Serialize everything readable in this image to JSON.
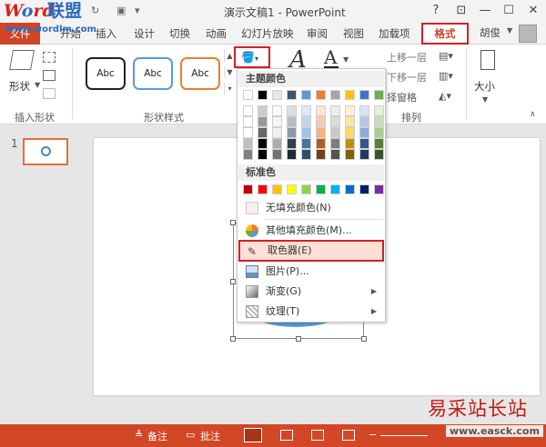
{
  "logo": {
    "part1": "W",
    "part2": "o",
    "part3": "rd",
    "cn": "联盟",
    "url": "www.wordlm.com"
  },
  "titlebar": {
    "title": "演示文稿1 - PowerPoint",
    "help": "?",
    "restore": "⊡",
    "minimize": "—",
    "maximize": "☐",
    "close": "✕"
  },
  "tabs": {
    "file": "文件",
    "start": "开始",
    "insert": "插入",
    "design": "设计",
    "transition": "切换",
    "animation": "动画",
    "slideshow": "幻灯片放映",
    "review": "审阅",
    "view": "视图",
    "addins": "加载项",
    "format": "格式",
    "user": "胡俊"
  },
  "ribbon": {
    "insert_shape_label": "插入形状",
    "shape_button": "形状",
    "shape_styles_label": "形状样式",
    "abc": "Abc",
    "arrange_label": "排列",
    "bring_forward": "上移一层",
    "send_backward": "下移一层",
    "selection_pane": "择窗格",
    "size": "大小"
  },
  "dropdown": {
    "theme_colors_header": "主题颜色",
    "standard_colors_header": "标准色",
    "no_fill": "无填充颜色(N)",
    "more_colors": "其他填充颜色(M)...",
    "eyedropper": "取色器(E)",
    "picture": "图片(P)...",
    "gradient": "渐变(G)",
    "texture": "纹理(T)",
    "theme_colors": [
      "#ffffff",
      "#000000",
      "#e7e6e6",
      "#44546a",
      "#5b9bd5",
      "#ed7d31",
      "#a5a5a5",
      "#ffc000",
      "#4472c4",
      "#70ad47"
    ],
    "standard_colors": [
      "#c00000",
      "#ff0000",
      "#ffc000",
      "#ffff00",
      "#92d050",
      "#00b050",
      "#00b0f0",
      "#0070c0",
      "#002060",
      "#7030a0"
    ]
  },
  "slide_pane": {
    "slide_number": "1"
  },
  "statusbar": {
    "notes": "备注",
    "comments": "批注"
  },
  "watermark": {
    "cn": "易采站长站",
    "url": "www.easck.com"
  },
  "colors": {
    "accent": "#d24726",
    "highlight_border": "#d42026",
    "shape_fill": "#5b9bd5"
  }
}
